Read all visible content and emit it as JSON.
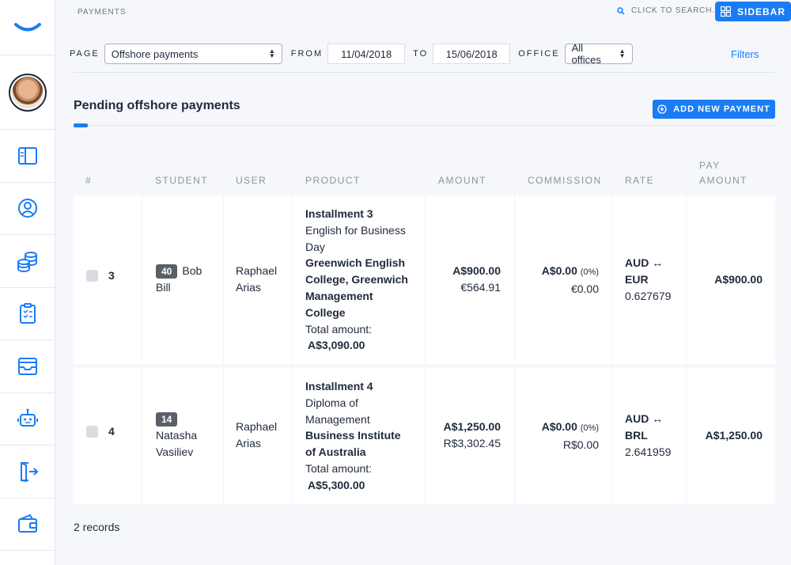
{
  "header": {
    "breadcrumb": "PAYMENTS",
    "search_placeholder": "CLICK TO SEARCH...",
    "sidebar_button": "SIDEBAR"
  },
  "sidebar": {
    "items": [
      {
        "icon": "layout-icon"
      },
      {
        "icon": "user-circle-icon"
      },
      {
        "icon": "coins-icon"
      },
      {
        "icon": "clipboard-check-icon"
      },
      {
        "icon": "inbox-icon"
      },
      {
        "icon": "robot-icon"
      },
      {
        "icon": "exit-door-icon"
      },
      {
        "icon": "wallet-icon"
      }
    ]
  },
  "filters": {
    "page_label": "PAGE",
    "page_value": "Offshore payments",
    "from_label": "FROM",
    "from_value": "11/04/2018",
    "to_label": "TO",
    "to_value": "15/06/2018",
    "office_label": "OFFICE",
    "office_value": "All offices",
    "filters_link": "Filters"
  },
  "section": {
    "title": "Pending offshore payments",
    "add_button": "ADD NEW PAYMENT"
  },
  "table": {
    "headers": {
      "num": "#",
      "student": "STUDENT",
      "user": "USER",
      "product": "PRODUCT",
      "amount": "AMOUNT",
      "commission": "COMMISSION",
      "rate": "RATE",
      "pay_amount_1": "PAY",
      "pay_amount_2": "AMOUNT"
    },
    "rows": [
      {
        "num": "3",
        "student_badge": "40",
        "student_first": "Bob",
        "student_last": "Bill",
        "user_first": "Raphael",
        "user_last": "Arias",
        "product_installment": "Installment  3",
        "product_course_lines": [
          "English for Business",
          "Day"
        ],
        "product_school_lines": [
          "Greenwich English",
          "College, Greenwich",
          "Management",
          "College"
        ],
        "product_total_label": "Total amount:",
        "product_total_value": "A$3,090.00",
        "amount_main": "A$900.00",
        "amount_sub": "€564.91",
        "commission_main": "A$0.00",
        "commission_pct": "(0%)",
        "commission_sub": "€0.00",
        "rate_pair": "AUD ↔",
        "rate_currency": "EUR",
        "rate_value": "0.627679",
        "pay_amount": "A$900.00"
      },
      {
        "num": "4",
        "student_badge": "14",
        "student_first": "Natasha",
        "student_last": "Vasiliev",
        "user_first": "Raphael",
        "user_last": "Arias",
        "product_installment": "Installment  4",
        "product_course_lines": [
          "Diploma of",
          "Management"
        ],
        "product_school_lines": [
          "Business Institute",
          "of Australia"
        ],
        "product_total_label": "Total amount:",
        "product_total_value": "A$5,300.00",
        "amount_main": "A$1,250.00",
        "amount_sub": "R$3,302.45",
        "commission_main": "A$0.00",
        "commission_pct": "(0%)",
        "commission_sub": "R$0.00",
        "rate_pair": "AUD ↔",
        "rate_currency": "BRL",
        "rate_value": "2.641959",
        "pay_amount": "A$1,250.00"
      }
    ]
  },
  "footer": {
    "records": "2 records"
  },
  "colors": {
    "accent": "#1a7cf5",
    "badge": "#5a6069",
    "background": "#f5f7fb"
  }
}
